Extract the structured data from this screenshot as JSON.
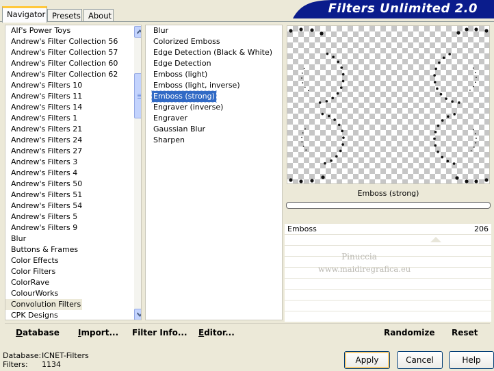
{
  "tabs": [
    {
      "label": "Navigator",
      "active": true
    },
    {
      "label": "Presets",
      "active": false
    },
    {
      "label": "About",
      "active": false
    }
  ],
  "banner": {
    "title": "Filters Unlimited 2.0",
    "color": "#0a1c8c"
  },
  "filter_categories": [
    "Alf's Power Toys",
    "Andrew's Filter Collection 56",
    "Andrew's Filter Collection 57",
    "Andrew's Filter Collection 60",
    "Andrew's Filter Collection 62",
    "Andrew's Filters 10",
    "Andrew's Filters 11",
    "Andrew's Filters 14",
    "Andrew's Filters 1",
    "Andrew's Filters 21",
    "Andrew's Filters 24",
    "Andrew's Filters 27",
    "Andrew's Filters 3",
    "Andrew's Filters 4",
    "Andrew's Filters 50",
    "Andrew's Filters 51",
    "Andrew's Filters 54",
    "Andrew's Filters 5",
    "Andrew's Filters 9",
    "Blur",
    "Buttons & Frames",
    "Color Effects",
    "Color Filters",
    "ColorRave",
    "ColourWorks",
    "Convolution Filters",
    "CPK Designs"
  ],
  "selected_category": "Convolution Filters",
  "effects": [
    "Blur",
    "Colorized Emboss",
    "Edge Detection (Black & White)",
    "Edge Detection",
    "Emboss (light)",
    "Emboss (light, inverse)",
    "Emboss (strong)",
    "Engraver (inverse)",
    "Engraver",
    "Gaussian Blur",
    "Sharpen"
  ],
  "selected_effect": "Emboss (strong)",
  "preview": {
    "effect_label": "Emboss (strong)"
  },
  "parameters": [
    {
      "label": "Emboss",
      "value": "206",
      "fraction": 0.81
    }
  ],
  "watermark": {
    "line1": "Pinuccia",
    "line2": "www.maidiregrafica.eu"
  },
  "actions": [
    {
      "label": "Database",
      "accel": "D",
      "rest": "atabase"
    },
    {
      "label": "Import...",
      "accel": "I",
      "rest": "mport..."
    },
    {
      "label": "Filter Info...",
      "accel": "",
      "rest": "Filter Info..."
    },
    {
      "label": "Editor...",
      "accel": "E",
      "rest": "ditor..."
    },
    {
      "label": "Randomize",
      "accel": "",
      "rest": "Randomize"
    },
    {
      "label": "Reset",
      "accel": "",
      "rest": "Reset"
    }
  ],
  "status": {
    "database_label": "Database:",
    "database_value": "ICNET-Filters",
    "filters_label": "Filters:",
    "filters_value": "1134"
  },
  "buttons": {
    "apply": "Apply",
    "cancel": "Cancel",
    "help": "Help"
  },
  "colors": {
    "selection": "#316ac5",
    "window_bg": "#ece9d8",
    "banner": "#0a1c8c"
  }
}
